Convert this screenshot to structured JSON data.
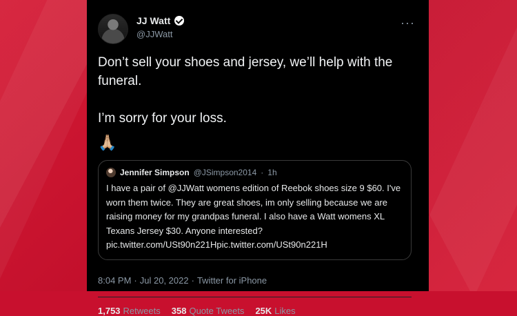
{
  "tweet": {
    "display_name": "JJ Watt",
    "handle": "@JJWatt",
    "text": "Don’t sell your shoes and jersey, we’ll help with the funeral.\n\nI’m sorry for your loss.",
    "emoji": "🙏🏼",
    "quoted_tweet": {
      "display_name": "Jennifer Simpson",
      "handle": "@JSimpson2014",
      "separator": "·",
      "time": "1h",
      "text": "I have a pair of @JJWatt womens edition of Reebok shoes size 9 $60. I've worn them twice. They are great shoes, im only selling because we are raising money for my grandpas funeral. I also have a Watt womens XL Texans Jersey $30. Anyone interested? pic.twitter.com/USt90n221Hpic.twitter.com/USt90n221H"
    },
    "timestamp": {
      "time": "8:04 PM",
      "date": "Jul 20, 2022",
      "source": "Twitter for iPhone"
    },
    "stats": {
      "retweets_count": "1,753",
      "retweets_label": "Retweets",
      "quote_tweets_count": "358",
      "quote_tweets_label": "Quote Tweets",
      "likes_count": "25K",
      "likes_label": "Likes"
    }
  },
  "colors": {
    "background_red": "#c8102e",
    "card_black": "#000000",
    "primary_text": "#e7e9ea",
    "secondary_text": "#8b98a5"
  },
  "icons": {
    "verified": "verified-badge-icon",
    "more": "more-horizontal-icon"
  }
}
